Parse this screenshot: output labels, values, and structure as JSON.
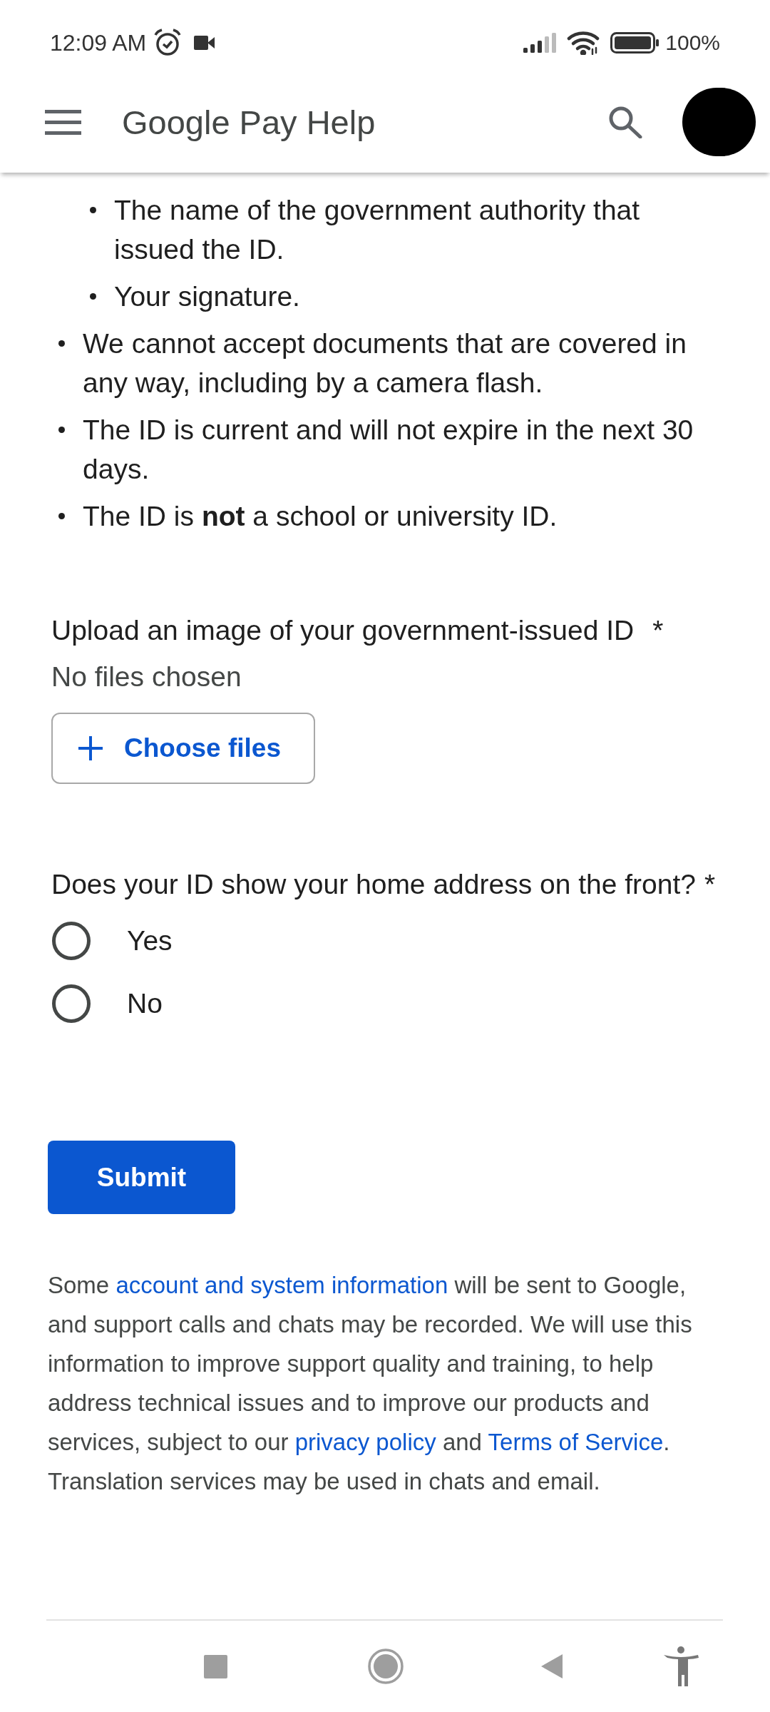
{
  "status_bar": {
    "time": "12:09 AM",
    "battery": "100%"
  },
  "app_bar": {
    "title": "Google Pay Help"
  },
  "requirements": [
    {
      "children": [
        {
          "text": "The name of the government authority that issued the ID."
        },
        {
          "text": "Your signature."
        }
      ]
    },
    {
      "text": "We cannot accept documents that are covered in any way, including by a camera flash."
    },
    {
      "text": "The ID is current and will not expire in the next 30 days."
    },
    {
      "text": "The ID is **not** a school or university ID."
    }
  ],
  "upload": {
    "label": "Upload an image of your government-issued ID",
    "required_mark": "*",
    "status": "No files chosen",
    "button": "Choose files"
  },
  "question": {
    "label": "Does your ID show your home address on the front?",
    "required_mark": "*",
    "options": [
      {
        "label": "Yes",
        "selected": false
      },
      {
        "label": "No",
        "selected": false
      }
    ]
  },
  "submit": "Submit",
  "disclaimer": [
    {
      "kind": "text",
      "text": "Some "
    },
    {
      "kind": "link",
      "text": "account and system information"
    },
    {
      "kind": "text",
      "text": " will be sent to Google, and support calls and chats may be recorded. We will use this information to improve support quality and training, to help address technical issues and to improve our products and services, subject to our "
    },
    {
      "kind": "link",
      "text": "privacy policy"
    },
    {
      "kind": "text",
      "text": " and "
    },
    {
      "kind": "link",
      "text": "Terms of Service"
    },
    {
      "kind": "text",
      "text": ". Translation services may be used in chats and email."
    }
  ]
}
